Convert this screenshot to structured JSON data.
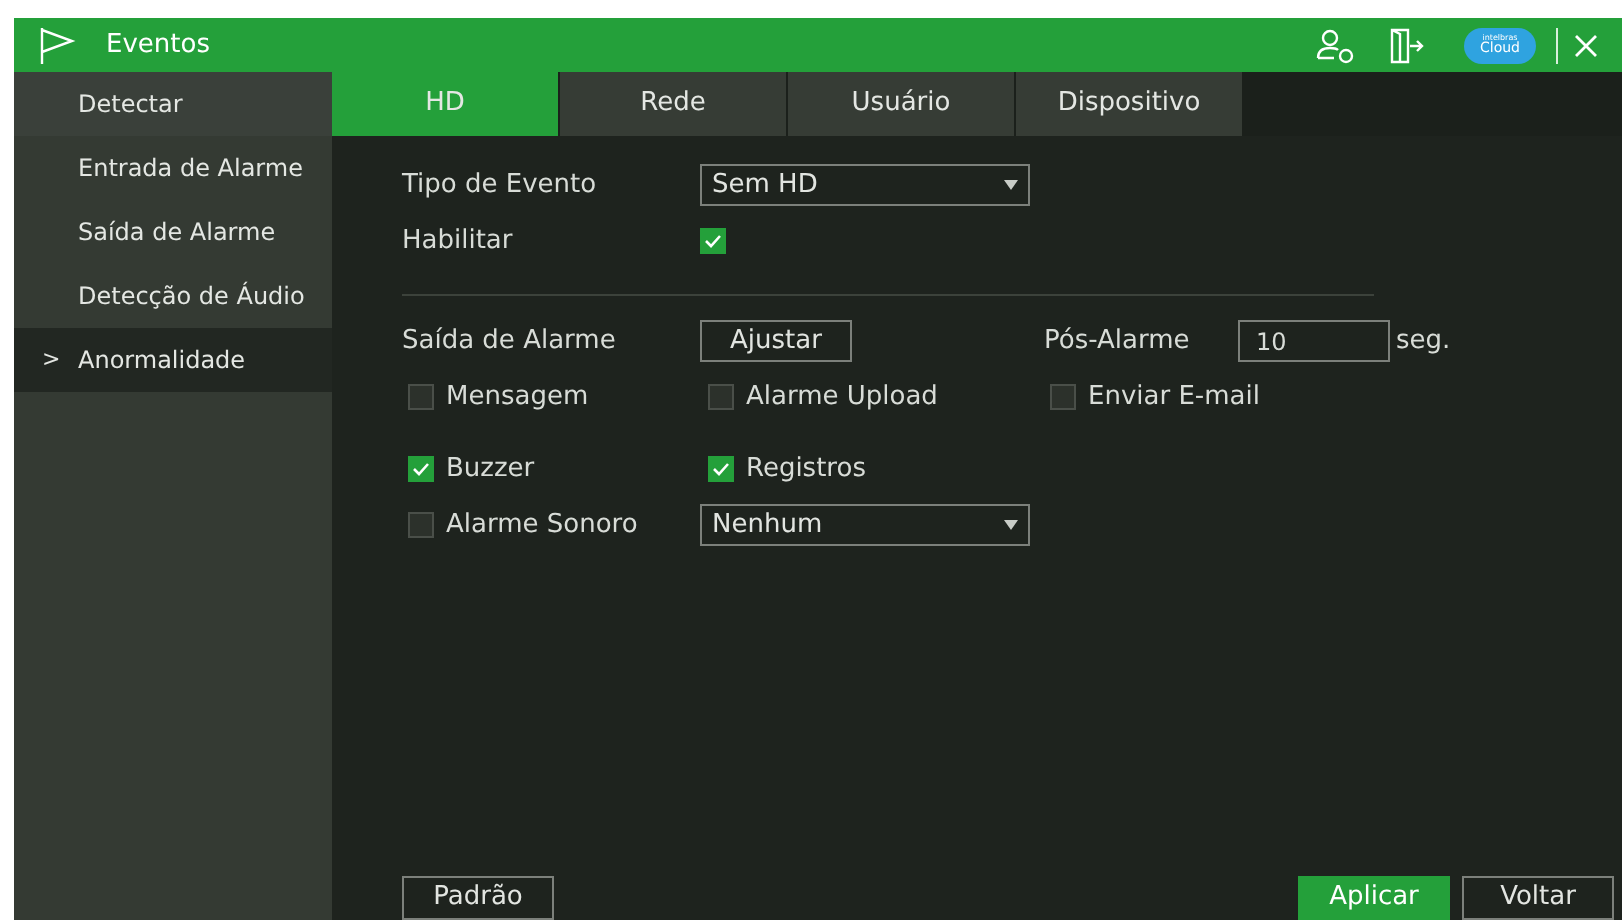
{
  "window": {
    "title": "Eventos",
    "cloud_label": "Cloud",
    "cloud_brand": "intelbras"
  },
  "sidebar": {
    "items": [
      {
        "label": "Detectar",
        "selected": false
      },
      {
        "label": "Entrada de Alarme",
        "selected": false
      },
      {
        "label": "Saída de Alarme",
        "selected": false
      },
      {
        "label": "Detecção de Áudio",
        "selected": false
      },
      {
        "label": "Anormalidade",
        "selected": true,
        "arrow": ">"
      }
    ]
  },
  "tabs": [
    {
      "label": "HD",
      "selected": true
    },
    {
      "label": "Rede",
      "selected": false
    },
    {
      "label": "Usuário",
      "selected": false
    },
    {
      "label": "Dispositivo",
      "selected": false
    }
  ],
  "form": {
    "event_type": {
      "label": "Tipo de Evento",
      "value": "Sem HD"
    },
    "enable": {
      "label": "Habilitar",
      "checked": true
    },
    "alarm_out": {
      "label": "Saída de Alarme",
      "button": "Ajustar"
    },
    "post_alarm": {
      "label": "Pós-Alarme",
      "value": "10",
      "unit": "seg."
    },
    "options_row1": [
      {
        "label": "Mensagem",
        "checked": false
      },
      {
        "label": "Alarme Upload",
        "checked": false
      },
      {
        "label": "Enviar E-mail",
        "checked": false
      }
    ],
    "options_row2": [
      {
        "label": "Buzzer",
        "checked": true
      },
      {
        "label": "Registros",
        "checked": true
      }
    ],
    "sound": {
      "label": "Alarme Sonoro",
      "checked": false,
      "value": "Nenhum"
    }
  },
  "buttons": {
    "default": "Padrão",
    "apply": "Aplicar",
    "back": "Voltar"
  }
}
